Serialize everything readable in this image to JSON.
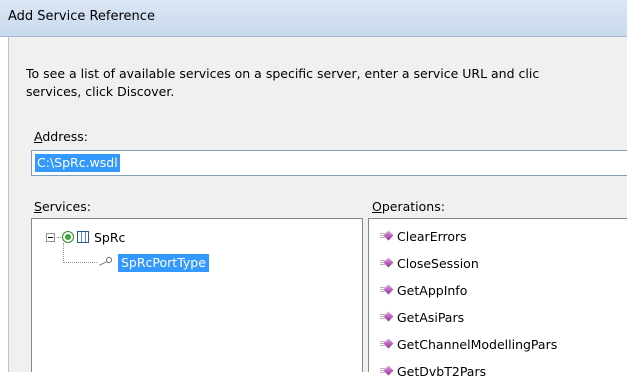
{
  "window": {
    "title": "Add Service Reference"
  },
  "instructions": {
    "line1": "To see a list of available services on a specific server, enter a service URL and clic",
    "line2": "services, click Discover."
  },
  "address": {
    "label_accel": "A",
    "label_rest": "ddress:",
    "value": "C:\\SpRc.wsdl"
  },
  "services": {
    "label_accel": "S",
    "label_rest": "ervices:",
    "tree": {
      "root": "SpRc",
      "child": "SpRcPortType"
    }
  },
  "operations": {
    "label_accel": "O",
    "label_rest": "perations:",
    "items": [
      "ClearErrors",
      "CloseSession",
      "GetAppInfo",
      "GetAsiPars",
      "GetChannelModellingPars",
      "GetDvbT2Pars"
    ]
  },
  "icons": {
    "expander": "tree-expander-minus-icon",
    "service": "service-globe-icon",
    "contract": "contract-grid-icon",
    "port": "port-interface-icon",
    "operation": "operation-method-icon"
  },
  "colors": {
    "selection": "#3399ff",
    "titlebar": "#c9d9ee",
    "dialog_bg": "#f0f0f0"
  }
}
